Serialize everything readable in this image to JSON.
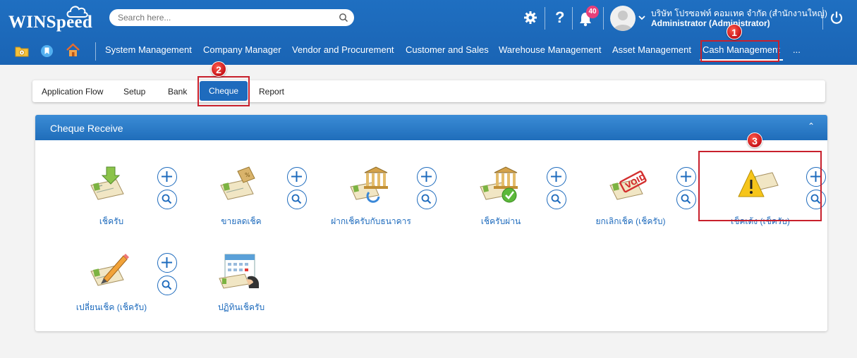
{
  "header": {
    "logo_text": "WINSpeed",
    "search_placeholder": "Search here...",
    "notification_count": "40",
    "company_name": "บริษัท โปรซอฟท์ คอมเทค จำกัด (สำนักงานใหญ่)",
    "user_role": "Administrator (Administrator)",
    "icons": [
      "gear-icon",
      "help-icon",
      "bell-icon",
      "chevron-down-icon",
      "power-icon"
    ]
  },
  "nav": {
    "quick_icons": [
      "folder-icon",
      "bookmark-icon",
      "home-icon"
    ],
    "items": [
      {
        "label": "System Management"
      },
      {
        "label": "Company Manager"
      },
      {
        "label": "Vendor and Procurement"
      },
      {
        "label": "Customer and Sales"
      },
      {
        "label": "Warehouse Management"
      },
      {
        "label": "Asset Management"
      },
      {
        "label": "Cash Management",
        "active": true
      },
      {
        "label": "..."
      }
    ]
  },
  "tabs": [
    {
      "label": "Application Flow"
    },
    {
      "label": "Setup"
    },
    {
      "label": "Bank"
    },
    {
      "label": "Cheque",
      "active": true
    },
    {
      "label": "Report"
    }
  ],
  "annotations": [
    "1",
    "2",
    "3"
  ],
  "panel": {
    "title": "Cheque Receive",
    "items": [
      {
        "label": "เช็ครับ",
        "icon": "cheque-receive-icon"
      },
      {
        "label": "ขายลดเช็ค",
        "icon": "cheque-discount-icon"
      },
      {
        "label": "ฝากเช็ครับกับธนาคาร",
        "icon": "cheque-deposit-icon"
      },
      {
        "label": "เช็ครับผ่าน",
        "icon": "cheque-pass-icon"
      },
      {
        "label": "ยกเลิกเช็ค (เช็ครับ)",
        "icon": "cheque-void-icon"
      },
      {
        "label": "เช็คเด้ง (เช็ครับ)",
        "icon": "cheque-bounce-icon"
      },
      {
        "label": "เปลี่ยนเช็ค (เช็ครับ)",
        "icon": "cheque-change-icon"
      },
      {
        "label": "ปฏิทินเช็ครับ",
        "icon": "cheque-calendar-icon"
      }
    ]
  },
  "colors": {
    "header_blue": "#1f6fc1",
    "accent_blue": "#1e6bbd",
    "annotation_red": "#c8202c",
    "badge_pink": "#e8407a"
  }
}
